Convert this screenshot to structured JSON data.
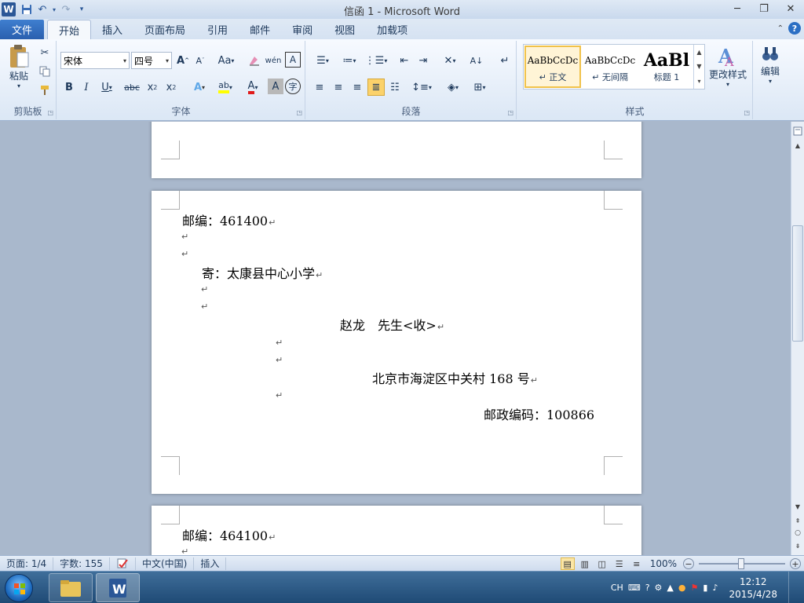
{
  "window": {
    "title": "信函 1 - Microsoft Word",
    "app_icon": "W"
  },
  "tabs": {
    "file": "文件",
    "items": [
      "开始",
      "插入",
      "页面布局",
      "引用",
      "邮件",
      "审阅",
      "视图",
      "加载项"
    ],
    "active_index": 0
  },
  "ribbon": {
    "clipboard": {
      "label": "剪贴板",
      "paste": "粘贴"
    },
    "font": {
      "label": "字体",
      "font_name": "宋体",
      "font_size": "四号"
    },
    "paragraph": {
      "label": "段落"
    },
    "styles": {
      "label": "样式",
      "items": [
        {
          "sample": "AaBbCcDc",
          "name": "↵ 正文"
        },
        {
          "sample": "AaBbCcDc",
          "name": "↵ 无间隔"
        },
        {
          "sample": "AaBl",
          "name": "标题 1"
        }
      ],
      "change_styles": "更改样式"
    },
    "editing": {
      "label": "编辑"
    }
  },
  "document": {
    "page2": {
      "zip_line": "邮编：461400",
      "sender": "寄：太康县中心小学",
      "recipient": "赵龙　先生<收>",
      "address": "北京市海淀区中关村 168 号",
      "postcode": "邮政编码：100866"
    },
    "page3": {
      "zip_line": "邮编：464100"
    },
    "paragraph_mark": "↵"
  },
  "statusbar": {
    "page": "页面: 1/4",
    "words": "字数: 155",
    "language": "中文(中国)",
    "mode": "插入",
    "zoom": "100%",
    "zoom_level_percent": 100
  },
  "taskbar": {
    "ime": "CH",
    "time": "12:12",
    "date": "2015/4/28"
  },
  "colors": {
    "accent": "#2b5797",
    "file_tab": "#2a5fae",
    "selected_style": "#f0c24a"
  }
}
